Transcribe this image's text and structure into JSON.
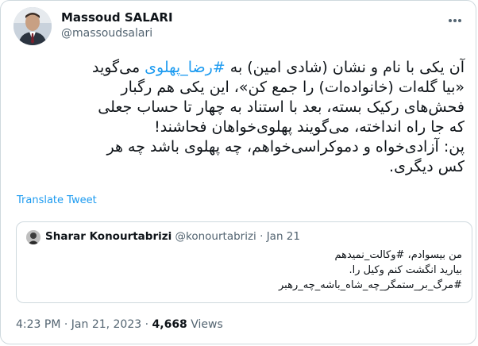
{
  "author": {
    "name": "Massoud SALARI",
    "handle": "@massoudsalari"
  },
  "tweet": {
    "line1_a": "آن یکی با نام و نشان (شادی امین) به ",
    "line1_tag": "#رضا_پهلوی",
    "line1_b": " می‌گوید",
    "line2": "«بیا گله‌ات (خانواده‌ات) را جمع کن»، این یکی هم رگبار",
    "line3": "فحش‌های رکیک بسته، بعد با استناد به چهار تا حساب جعلی",
    "line4": "که جا راه انداخته، می‌گویند پهلوی‌خواهان فحاشند!",
    "line5": "پن: آزادی‌خواه و دموکراسی‌خواهم، چه پهلوی باشد چه هر",
    "line6": "کس دیگری."
  },
  "translate_label": "Translate Tweet",
  "quoted": {
    "name": "Sharar Konourtabrizi",
    "handle": "@konourtabrizi",
    "separator": "·",
    "date": "Jan 21",
    "line1": "من بیسوادم، #وکالت_نمیدهم",
    "line2": "بیارید انگشت کنم وکیل را.",
    "line3": "#مرگ_بر_ستمگر_چه_شاه_باشه_چه_رهبر"
  },
  "footer": {
    "time": "4:23 PM",
    "separator": "·",
    "date": "Jan 21, 2023",
    "views_count": "4,668",
    "views_label": "Views"
  },
  "icons": {
    "more": "more-horizontal-icon"
  },
  "colors": {
    "accent": "#1d9bf0",
    "text": "#0f1419",
    "secondary": "#536471",
    "border": "#cfd9de"
  }
}
